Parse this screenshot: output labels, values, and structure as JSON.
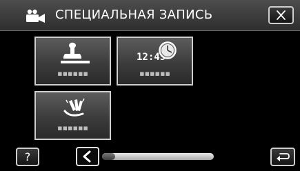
{
  "header": {
    "title": "СПЕЦИАЛЬНАЯ ЗАПИСЬ",
    "mode_icon": "movie-camera-icon",
    "close_icon": "close-icon"
  },
  "tiles": [
    {
      "label": "▪▪▪▪▪▪",
      "icon": "stamp-icon"
    },
    {
      "label": "▪▪▪▪▪▪",
      "icon": "time-stamp-icon",
      "clock_text": "12:45"
    },
    {
      "label": "▪▪▪▪▪▪",
      "icon": "animation-effect-icon"
    }
  ],
  "footer": {
    "help_label": "?",
    "prev_icon": "chevron-left-icon",
    "back_icon": "return-icon",
    "scroll_position": 0.0,
    "scroll_visible_fraction": 0.12
  },
  "colors": {
    "background": "#000000",
    "border": "#cfcfcf",
    "text": "#ffffff"
  }
}
